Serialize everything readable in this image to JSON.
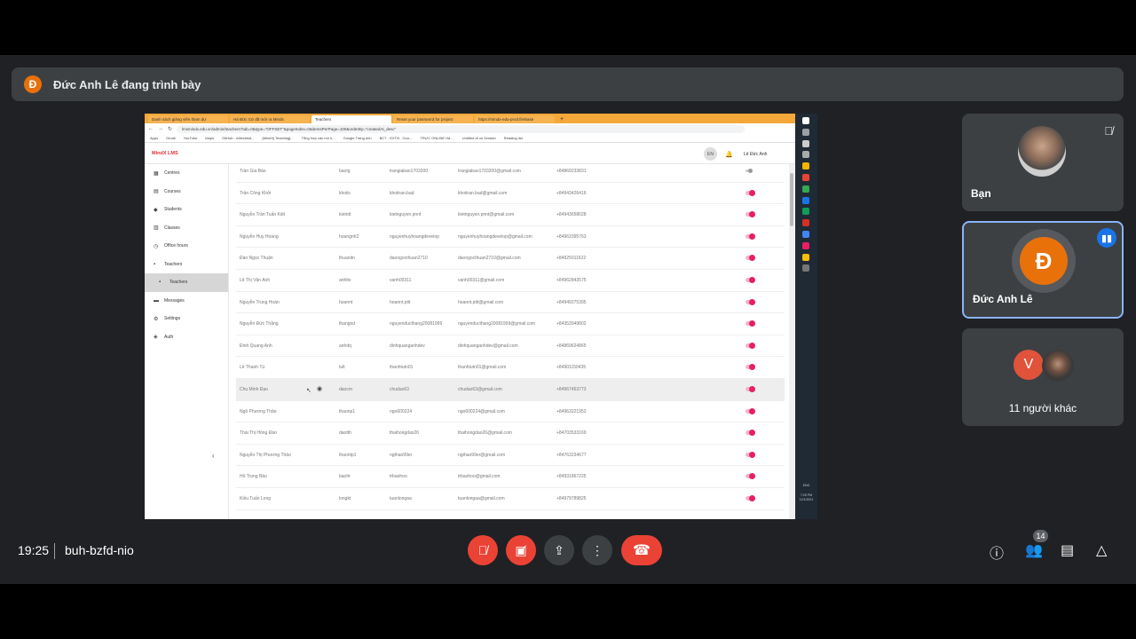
{
  "banner": {
    "avatar_letter": "Đ",
    "text": "Đức Anh Lê đang trình bày"
  },
  "browser": {
    "tabs": [
      "Danh sách giảng viên tham dự",
      "Hà Đức Cử đã mời ra Minds",
      "Teachers",
      "Reset your password for project",
      "https://mindx-edu-prod.firebase",
      "+"
    ],
    "url": "lmsmindx.edu.vn/admin/teachers?tab=0&type=\"OFFSET\"&pageIndex=0&itemsPerPage=100&orderBy=\"createdAt_desc\"",
    "bookmarks": [
      "Apps",
      "Gmail",
      "YouTube",
      "Maps",
      "GitHub - edtechkid...",
      "[MindX] Teaching]...",
      "Tổng hợp các mô h...",
      "Google Trang tính",
      "BCT - DXTN - Goo...",
      "TRỰC ONLINE Hà ...",
      "Untitled di on Scratch",
      "Reading list"
    ]
  },
  "app": {
    "logo": "MindX LMS",
    "lang": "EN",
    "user": "Lê Đức Anh"
  },
  "sidebar": [
    {
      "label": "Centres",
      "icon": "building-icon"
    },
    {
      "label": "Courses",
      "icon": "book-icon"
    },
    {
      "label": "Students",
      "icon": "student-icon"
    },
    {
      "label": "Classes",
      "icon": "class-icon"
    },
    {
      "label": "Office hours",
      "icon": "clock-icon"
    },
    {
      "label": "Teachers",
      "icon": "person-icon"
    },
    {
      "label": "Teachers",
      "icon": "person-icon",
      "sub": true,
      "active": true
    },
    {
      "label": "Messages",
      "icon": "message-icon"
    },
    {
      "label": "Settings",
      "icon": "gear-icon"
    },
    {
      "label": "Auth",
      "icon": "shield-icon"
    }
  ],
  "teachers": [
    {
      "name": "Trần Gia Bảo",
      "code": "baotg",
      "user": "trangiabao1703200",
      "email": "trangiabao1703200@gmail.com",
      "phone": "+84869233831",
      "active": false
    },
    {
      "name": "Trần Công Khởi",
      "code": "khoitc",
      "user": "khoitran.bad",
      "email": "khoitran.bad@gmail.com",
      "phone": "+84943426416",
      "active": true
    },
    {
      "name": "Nguyễn Trần Tuấn Kiệt",
      "code": "kietntt",
      "user": "kietnguyen.pnnt",
      "email": "kietnguyen.pnnt@gmail.com",
      "phone": "+84943658028",
      "active": true
    },
    {
      "name": "Nguyễn Huy Hoàng",
      "code": "hoangnh2",
      "user": "nguyenhuyhoangdevelop",
      "email": "nguyenhuyhoangdevelop@gmail.com",
      "phone": "+84963395763",
      "active": true
    },
    {
      "name": "Đào Ngọc Thuận",
      "code": "thuandn",
      "user": "daongocthuan2710",
      "email": "daongocthuan2710@gmail.com",
      "phone": "+84925011622",
      "active": true
    },
    {
      "name": "Lê Thị Vân Anh",
      "code": "anhltv",
      "user": "vanh00311",
      "email": "vanh00311@gmail.com",
      "phone": "+84962843575",
      "active": true
    },
    {
      "name": "Nguyễn Trung Hoàn",
      "code": "hoannt",
      "user": "hoannt.ptit",
      "email": "hoannt.ptit@gmail.com",
      "phone": "+84949275395",
      "active": true
    },
    {
      "name": "Nguyễn Đức Thắng",
      "code": "thangnd",
      "user": "nguyenducthang20081999",
      "email": "nguyenducthang20081999@gmail.com",
      "phone": "+84353949802",
      "active": true
    },
    {
      "name": "Đinh Quang Anh",
      "code": "anhdq",
      "user": "dinhquanganhdev",
      "email": "dinhquanganhdev@gmail.com",
      "phone": "+84869624865",
      "active": true
    },
    {
      "name": "Lê Thanh Tú",
      "code": "tult",
      "user": "thanhtutn01",
      "email": "thanhtutn01@gmail.com",
      "phone": "+84901150435",
      "active": true
    },
    {
      "name": "Chu Minh Đạo",
      "code": "daocm",
      "user": "chudao63",
      "email": "chudao63@gmail.com",
      "phone": "+84967453773",
      "active": true,
      "highlight": true
    },
    {
      "name": "Ngô Phương Thảo",
      "code": "thaonp1",
      "user": "ngo600224",
      "email": "ngo600224@gmail.com",
      "phone": "+84963221952",
      "active": true
    },
    {
      "name": "Thái Thị Hồng Đào",
      "code": "daotth",
      "user": "thaihongdao26",
      "email": "thaihongdao26@gmail.com",
      "phone": "+84703533169",
      "active": true
    },
    {
      "name": "Nguyễn Thị Phương Thảo",
      "code": "thaontp1",
      "user": "ngthao99er",
      "email": "ngthao99er@gmail.com",
      "phone": "+84763234677",
      "active": true
    },
    {
      "name": "Hồ Trọng Bảo",
      "code": "baoht",
      "user": "trbaohoo",
      "email": "trbaohoo@gmail.com",
      "phone": "+84931867225",
      "active": true
    },
    {
      "name": "Kiều Tuấn Long",
      "code": "longkt",
      "user": "tuanlongaa",
      "email": "tuanlongaa@gmail.com",
      "phone": "+84979789825",
      "active": true
    }
  ],
  "taskbar": {
    "lang": "ENG",
    "clock": "7:25 PM",
    "date": "12/1/2021"
  },
  "participants": {
    "self": {
      "name": "Bạn"
    },
    "presenter": {
      "name": "Đức Anh Lê",
      "letter": "Đ"
    },
    "others": {
      "label": "11 người khác",
      "letter": "V"
    }
  },
  "controls": {
    "time": "19:25",
    "meeting_code": "buh-bzfd-nio",
    "people_count": "14"
  },
  "colors": {
    "end_call": "#ea4335",
    "presenter_avatar": "#e8710a",
    "speaking": "#1a73e8"
  }
}
